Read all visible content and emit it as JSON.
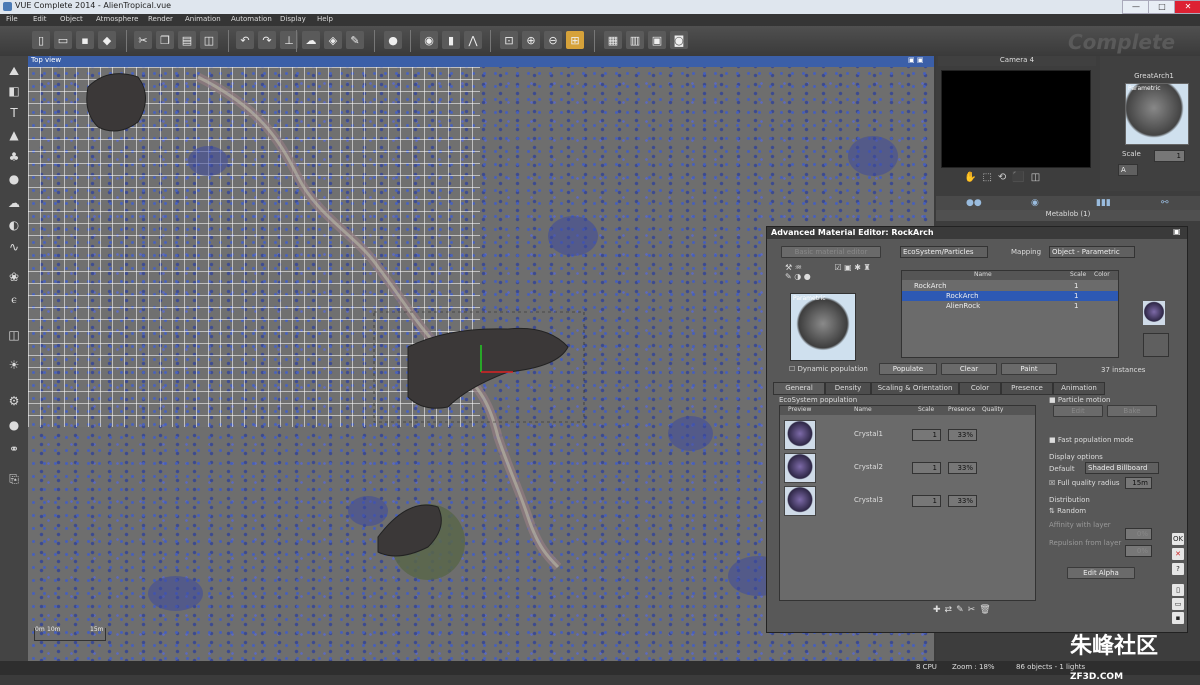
{
  "title_bar": {
    "text": "VUE Complete 2014 - AlienTropical.vue",
    "buttons": [
      "—",
      "□",
      "✕"
    ]
  },
  "menu": [
    "File",
    "Edit",
    "Object",
    "Atmosphere",
    "Render",
    "Animation",
    "Automation",
    "Display",
    "Help"
  ],
  "viewport": {
    "label": "Top view",
    "scale_labels": [
      "0m",
      "10m",
      "15m"
    ]
  },
  "brand": "Complete",
  "camera": {
    "label": "Camera 4"
  },
  "material_preview": {
    "name": "GreatArch1",
    "tag": "Parametric",
    "scale_label": "Scale",
    "scale_value": "1",
    "mode": "A"
  },
  "layer": {
    "label": "Metablob (1)"
  },
  "ame": {
    "title": "Advanced Material Editor: RockArch",
    "basic_btn": "Basic material editor",
    "type": "EcoSystem/Particles",
    "mapping_label": "Mapping",
    "mapping_value": "Object - Parametric",
    "preview_tag": "Parametric",
    "dynamic_label": "Dynamic population",
    "tree_cols": [
      "Name",
      "Scale",
      "Color"
    ],
    "tree_rows": [
      {
        "name": "RockArch",
        "scale": "1",
        "indent": 1
      },
      {
        "name": "RockArch",
        "scale": "1",
        "indent": 2
      },
      {
        "name": "AlienRock",
        "scale": "1",
        "indent": 2
      }
    ],
    "populate": "Populate",
    "clear": "Clear",
    "paint": "Paint",
    "instances": "37 instances",
    "tabs": [
      "General",
      "Density",
      "Scaling & Orientation",
      "Color",
      "Presence",
      "Animation"
    ],
    "eco_title": "EcoSystem population",
    "eco_cols": [
      "Preview",
      "Name",
      "Scale",
      "Presence",
      "Quality"
    ],
    "eco_rows": [
      {
        "name": "Crystal1",
        "scale": "1",
        "presence": "33%"
      },
      {
        "name": "Crystal2",
        "scale": "1",
        "presence": "33%"
      },
      {
        "name": "Crystal3",
        "scale": "1",
        "presence": "33%"
      }
    ],
    "particle_motion": "Particle motion",
    "edit": "Edit",
    "bake": "Bake",
    "fast_pop": "Fast population mode",
    "display_options": "Display options",
    "default_label": "Default",
    "default_value": "Shaded Billboard",
    "full_quality": "Full quality radius",
    "radius_value": "15m",
    "distribution": "Distribution",
    "random": "Random",
    "affinity": "Affinity with layer",
    "affinity_value": "0%",
    "repulsion": "Repulsion from layer",
    "repulsion_value": "0%",
    "edit_alpha": "Edit Alpha"
  },
  "status": {
    "cpu": "8 CPU",
    "zoom": "Zoom : 18%",
    "objects": "86 objects - 1 lights"
  },
  "watermark": {
    "main": "朱峰社区",
    "sub": "ZF3D.COM"
  }
}
